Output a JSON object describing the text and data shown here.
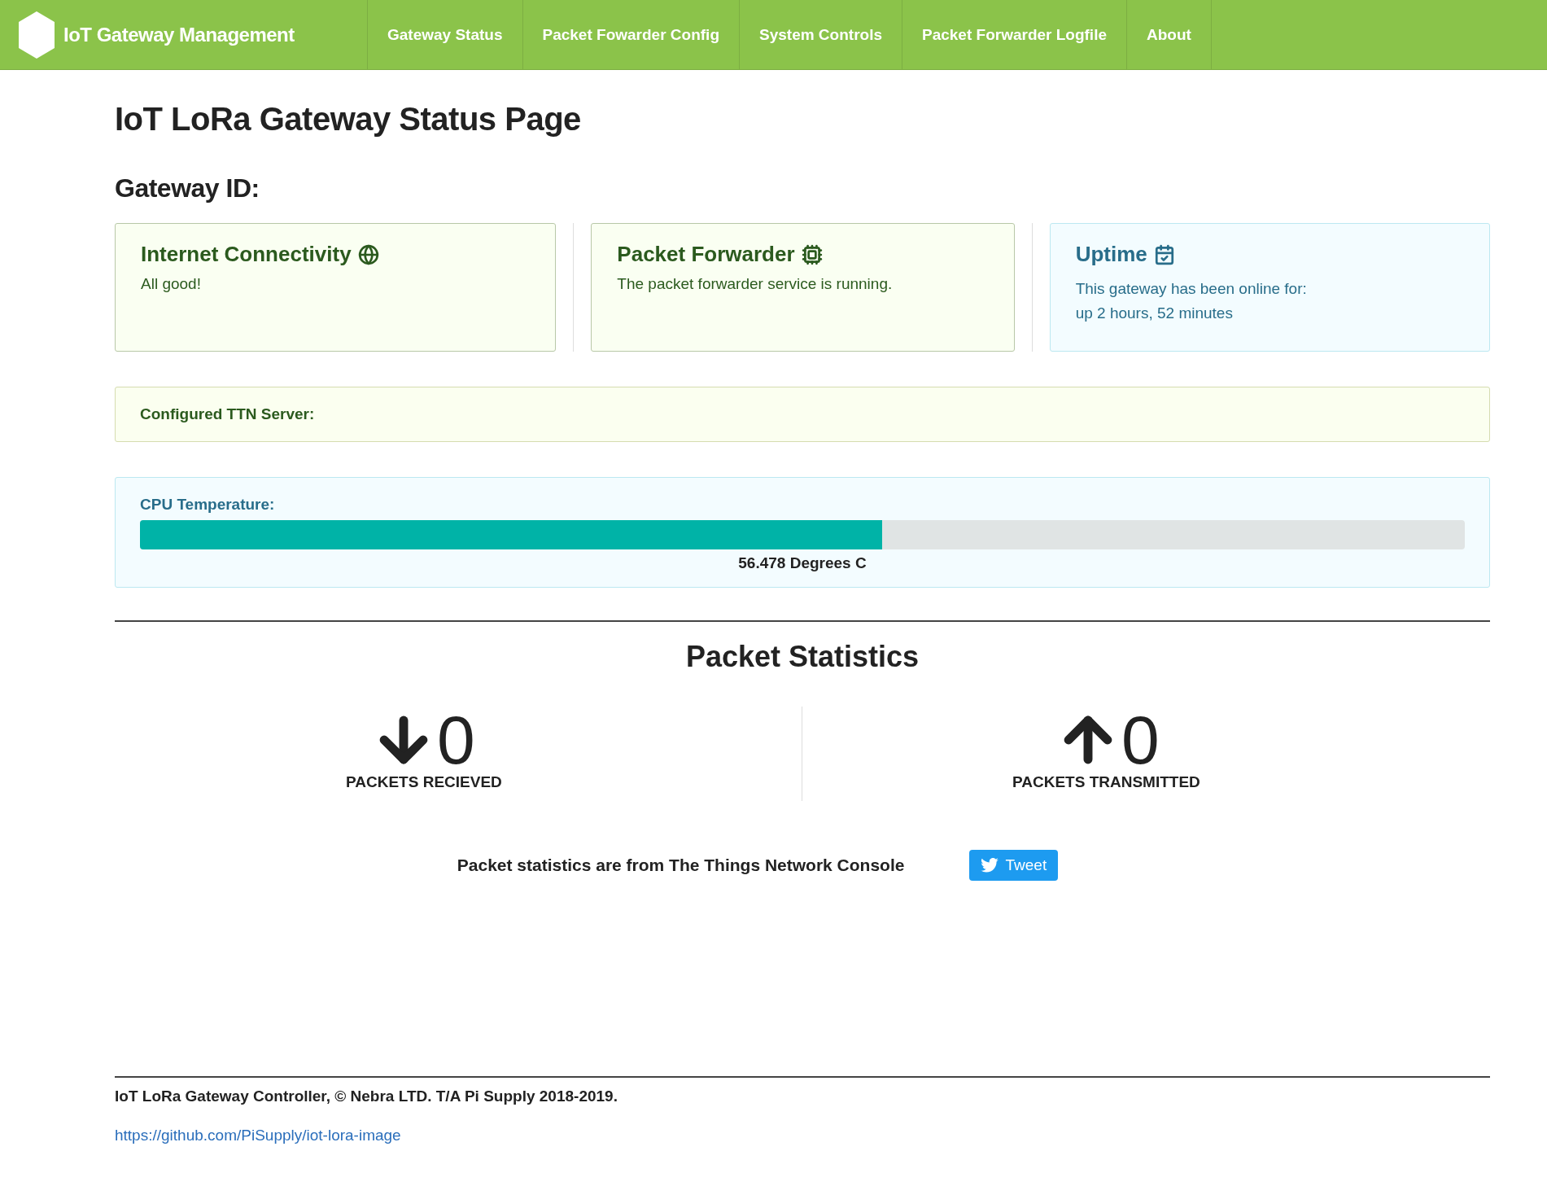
{
  "navbar": {
    "brand": "IoT Gateway Management",
    "items": [
      "Gateway Status",
      "Packet Fowarder Config",
      "System Controls",
      "Packet Forwarder Logfile",
      "About"
    ]
  },
  "page_title": "IoT LoRa Gateway Status Page",
  "gateway_id_label": "Gateway ID:",
  "status_cards": [
    {
      "kind": "success",
      "title": "Internet Connectivity",
      "lines": [
        "All good!"
      ]
    },
    {
      "kind": "success",
      "title": "Packet Forwarder",
      "lines": [
        "The packet forwarder service is running."
      ]
    },
    {
      "kind": "info",
      "title": "Uptime",
      "lines": [
        "This gateway has been online for:",
        "up 2 hours, 52 minutes"
      ]
    }
  ],
  "ttn_server": {
    "label": "Configured TTN Server:"
  },
  "cpu_temperature": {
    "label": "CPU Temperature:",
    "level": 0.56,
    "reading": "56.478 Degrees C"
  },
  "packet_statistics": {
    "title": "Packet Statistics",
    "stats": [
      {
        "kind": "down",
        "value": "0",
        "label": "PACKETS RECIEVED"
      },
      {
        "kind": "up",
        "value": "0",
        "label": "PACKETS TRANSMITTED"
      }
    ],
    "note": "Packet statistics are from The Things Network Console",
    "tweet_button": "Tweet"
  },
  "footer": {
    "copyright": "IoT LoRa Gateway Controller, © Nebra LTD. T/A Pi Supply 2018-2019.",
    "link": "https://github.com/PiSupply/iot-lora-image"
  }
}
